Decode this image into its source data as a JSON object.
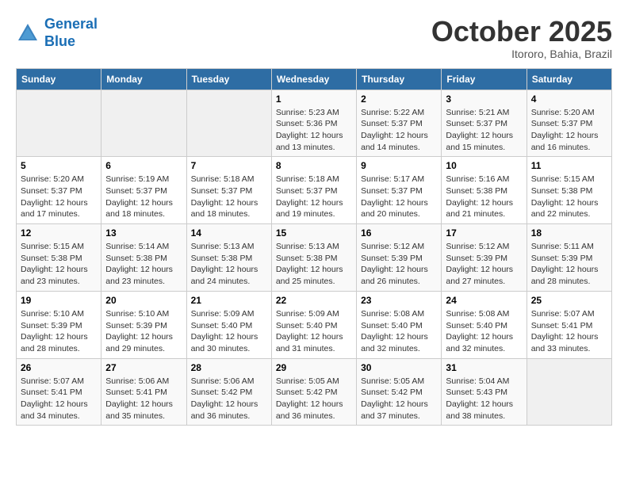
{
  "header": {
    "logo_line1": "General",
    "logo_line2": "Blue",
    "month": "October 2025",
    "location": "Itororo, Bahia, Brazil"
  },
  "weekdays": [
    "Sunday",
    "Monday",
    "Tuesday",
    "Wednesday",
    "Thursday",
    "Friday",
    "Saturday"
  ],
  "weeks": [
    [
      {
        "day": "",
        "info": ""
      },
      {
        "day": "",
        "info": ""
      },
      {
        "day": "",
        "info": ""
      },
      {
        "day": "1",
        "info": "Sunrise: 5:23 AM\nSunset: 5:36 PM\nDaylight: 12 hours\nand 13 minutes."
      },
      {
        "day": "2",
        "info": "Sunrise: 5:22 AM\nSunset: 5:37 PM\nDaylight: 12 hours\nand 14 minutes."
      },
      {
        "day": "3",
        "info": "Sunrise: 5:21 AM\nSunset: 5:37 PM\nDaylight: 12 hours\nand 15 minutes."
      },
      {
        "day": "4",
        "info": "Sunrise: 5:20 AM\nSunset: 5:37 PM\nDaylight: 12 hours\nand 16 minutes."
      }
    ],
    [
      {
        "day": "5",
        "info": "Sunrise: 5:20 AM\nSunset: 5:37 PM\nDaylight: 12 hours\nand 17 minutes."
      },
      {
        "day": "6",
        "info": "Sunrise: 5:19 AM\nSunset: 5:37 PM\nDaylight: 12 hours\nand 18 minutes."
      },
      {
        "day": "7",
        "info": "Sunrise: 5:18 AM\nSunset: 5:37 PM\nDaylight: 12 hours\nand 18 minutes."
      },
      {
        "day": "8",
        "info": "Sunrise: 5:18 AM\nSunset: 5:37 PM\nDaylight: 12 hours\nand 19 minutes."
      },
      {
        "day": "9",
        "info": "Sunrise: 5:17 AM\nSunset: 5:37 PM\nDaylight: 12 hours\nand 20 minutes."
      },
      {
        "day": "10",
        "info": "Sunrise: 5:16 AM\nSunset: 5:38 PM\nDaylight: 12 hours\nand 21 minutes."
      },
      {
        "day": "11",
        "info": "Sunrise: 5:15 AM\nSunset: 5:38 PM\nDaylight: 12 hours\nand 22 minutes."
      }
    ],
    [
      {
        "day": "12",
        "info": "Sunrise: 5:15 AM\nSunset: 5:38 PM\nDaylight: 12 hours\nand 23 minutes."
      },
      {
        "day": "13",
        "info": "Sunrise: 5:14 AM\nSunset: 5:38 PM\nDaylight: 12 hours\nand 23 minutes."
      },
      {
        "day": "14",
        "info": "Sunrise: 5:13 AM\nSunset: 5:38 PM\nDaylight: 12 hours\nand 24 minutes."
      },
      {
        "day": "15",
        "info": "Sunrise: 5:13 AM\nSunset: 5:38 PM\nDaylight: 12 hours\nand 25 minutes."
      },
      {
        "day": "16",
        "info": "Sunrise: 5:12 AM\nSunset: 5:39 PM\nDaylight: 12 hours\nand 26 minutes."
      },
      {
        "day": "17",
        "info": "Sunrise: 5:12 AM\nSunset: 5:39 PM\nDaylight: 12 hours\nand 27 minutes."
      },
      {
        "day": "18",
        "info": "Sunrise: 5:11 AM\nSunset: 5:39 PM\nDaylight: 12 hours\nand 28 minutes."
      }
    ],
    [
      {
        "day": "19",
        "info": "Sunrise: 5:10 AM\nSunset: 5:39 PM\nDaylight: 12 hours\nand 28 minutes."
      },
      {
        "day": "20",
        "info": "Sunrise: 5:10 AM\nSunset: 5:39 PM\nDaylight: 12 hours\nand 29 minutes."
      },
      {
        "day": "21",
        "info": "Sunrise: 5:09 AM\nSunset: 5:40 PM\nDaylight: 12 hours\nand 30 minutes."
      },
      {
        "day": "22",
        "info": "Sunrise: 5:09 AM\nSunset: 5:40 PM\nDaylight: 12 hours\nand 31 minutes."
      },
      {
        "day": "23",
        "info": "Sunrise: 5:08 AM\nSunset: 5:40 PM\nDaylight: 12 hours\nand 32 minutes."
      },
      {
        "day": "24",
        "info": "Sunrise: 5:08 AM\nSunset: 5:40 PM\nDaylight: 12 hours\nand 32 minutes."
      },
      {
        "day": "25",
        "info": "Sunrise: 5:07 AM\nSunset: 5:41 PM\nDaylight: 12 hours\nand 33 minutes."
      }
    ],
    [
      {
        "day": "26",
        "info": "Sunrise: 5:07 AM\nSunset: 5:41 PM\nDaylight: 12 hours\nand 34 minutes."
      },
      {
        "day": "27",
        "info": "Sunrise: 5:06 AM\nSunset: 5:41 PM\nDaylight: 12 hours\nand 35 minutes."
      },
      {
        "day": "28",
        "info": "Sunrise: 5:06 AM\nSunset: 5:42 PM\nDaylight: 12 hours\nand 36 minutes."
      },
      {
        "day": "29",
        "info": "Sunrise: 5:05 AM\nSunset: 5:42 PM\nDaylight: 12 hours\nand 36 minutes."
      },
      {
        "day": "30",
        "info": "Sunrise: 5:05 AM\nSunset: 5:42 PM\nDaylight: 12 hours\nand 37 minutes."
      },
      {
        "day": "31",
        "info": "Sunrise: 5:04 AM\nSunset: 5:43 PM\nDaylight: 12 hours\nand 38 minutes."
      },
      {
        "day": "",
        "info": ""
      }
    ]
  ]
}
